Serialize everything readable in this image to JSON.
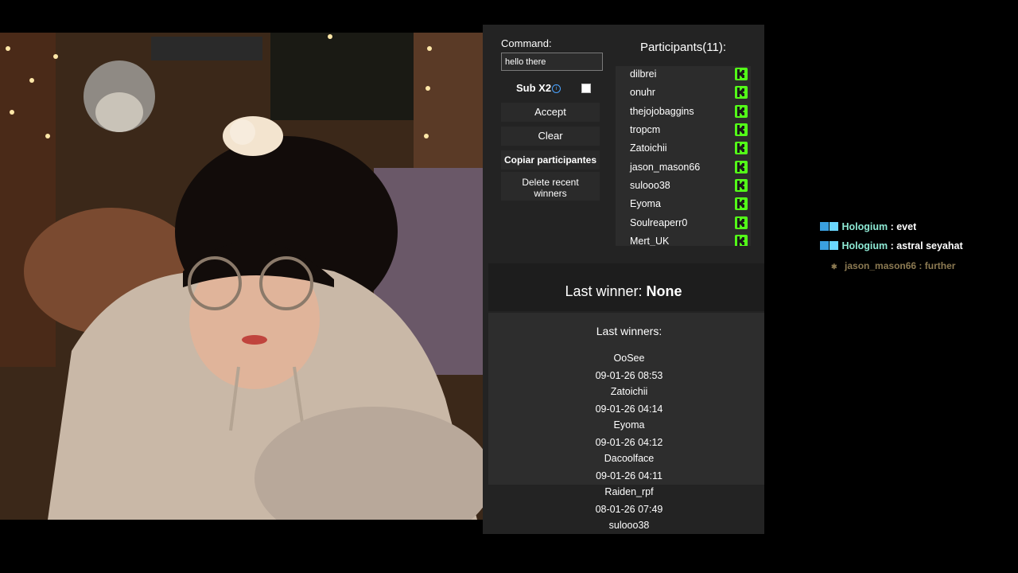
{
  "panel": {
    "command_label": "Command:",
    "command_value": "hello there",
    "sub_label": "Sub X2",
    "sub_checked": false,
    "buttons": {
      "accept": "Accept",
      "clear": "Clear",
      "copy": "Copiar participantes",
      "delete_line1": "Delete recent",
      "delete_line2": "winners"
    },
    "participants_title": "Participants(11):",
    "participants": [
      "dilbrei",
      "onuhr",
      "thejojobaggins",
      "tropcm",
      "Zatoichii",
      "jason_mason66",
      "sulooo38",
      "Eyoma",
      "Soulreaperr0",
      "Mert_UK"
    ],
    "platform_icon": "kick-icon",
    "platform_color": "#53fc18",
    "last_winner_label": "Last winner:",
    "last_winner_value": "None",
    "last_winners_title": "Last winners:",
    "last_winners": [
      {
        "name": "OoSee",
        "date": "09-01-26 08:53"
      },
      {
        "name": "Zatoichii",
        "date": "09-01-26 04:14"
      },
      {
        "name": "Eyoma",
        "date": "09-01-26 04:12"
      },
      {
        "name": "Dacoolface",
        "date": "09-01-26 04:11"
      },
      {
        "name": "Raiden_rpf",
        "date": "08-01-26 07:49"
      },
      {
        "name": "sulooo38",
        "date": ""
      }
    ]
  },
  "chat": [
    {
      "user": "Hologium",
      "text": "evet"
    },
    {
      "user": "Hologium",
      "text": "astral seyahat"
    },
    {
      "user": "jason_mason66",
      "text": "further"
    }
  ]
}
